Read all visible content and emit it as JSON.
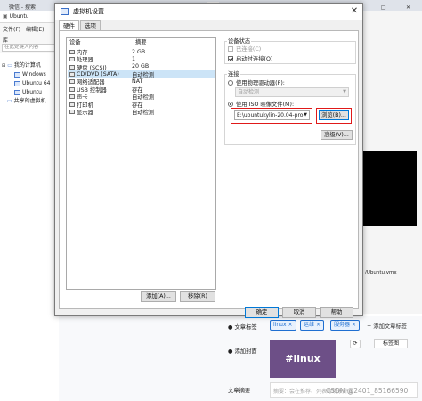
{
  "browser": {
    "tabs": [
      "微信 - 搜索",
      "Ubuntu - VMware"
    ],
    "window_controls": [
      "—",
      "□",
      "✕"
    ]
  },
  "vmware": {
    "title_fragment": "Ubuntu",
    "menu": [
      "文件(F)",
      "编辑(E)"
    ],
    "library_label": "库",
    "search_placeholder": "在此处键入内容",
    "tree": {
      "root": "我的计算机",
      "items": [
        "Windows",
        "Ubuntu 64",
        "Ubuntu"
      ],
      "shared": "共享的虚拟机"
    },
    "vmx_path": "/Ubuntu.vmx"
  },
  "dialog": {
    "title": "虚拟机设置",
    "close_glyph": "✕",
    "tabs": [
      "硬件",
      "选项"
    ],
    "device_list": {
      "headers": [
        "设备",
        "摘要"
      ],
      "rows": [
        {
          "device": "内存",
          "summary": "2 GB",
          "icon": "memory-icon"
        },
        {
          "device": "处理器",
          "summary": "1",
          "icon": "processor-icon"
        },
        {
          "device": "硬盘 (SCSI)",
          "summary": "20 GB",
          "icon": "hard-disk-icon"
        },
        {
          "device": "CD/DVD (SATA)",
          "summary": "自动检测",
          "icon": "cd-dvd-icon",
          "selected": true
        },
        {
          "device": "网络适配器",
          "summary": "NAT",
          "icon": "network-adapter-icon"
        },
        {
          "device": "USB 控制器",
          "summary": "存在",
          "icon": "usb-controller-icon"
        },
        {
          "device": "声卡",
          "summary": "自动检测",
          "icon": "sound-card-icon"
        },
        {
          "device": "打印机",
          "summary": "存在",
          "icon": "printer-icon"
        },
        {
          "device": "显示器",
          "summary": "自动检测",
          "icon": "display-icon"
        }
      ]
    },
    "add_button": "添加(A)...",
    "remove_button": "移除(R)",
    "device_status": {
      "label": "设备状态",
      "connected": "已连接(C)",
      "connect_on_power_on": "启动时连接(O)"
    },
    "connection": {
      "label": "连接",
      "physical_drive_option": "使用物理驱动器(P):",
      "physical_drive_value": "自动检测",
      "iso_option": "使用 ISO 映像文件(M):",
      "iso_value": "E:\\ubuntukylin-20.04-pro-sp",
      "browse_button": "浏览(B)...",
      "advanced_button": "高级(V)..."
    },
    "footer": {
      "ok": "确定",
      "cancel": "取消",
      "help": "帮助"
    },
    "colors": {
      "selection": "#cce4f7",
      "highlight_border": "#e01919",
      "accent": "#0078d7"
    }
  },
  "blog": {
    "tags_label": "文章标签",
    "tags": [
      "linux",
      "运维",
      "服务器"
    ],
    "add_tag": "+ 添加文章标签",
    "cover_label": "添加封面",
    "cover_text": "#linux",
    "cover_tab": "标签图",
    "summary_label": "文章摘要",
    "summary_placeholder": "摘要：会在推荐、列表等场景外露",
    "watermark": "CSDN @2401_85166590"
  }
}
